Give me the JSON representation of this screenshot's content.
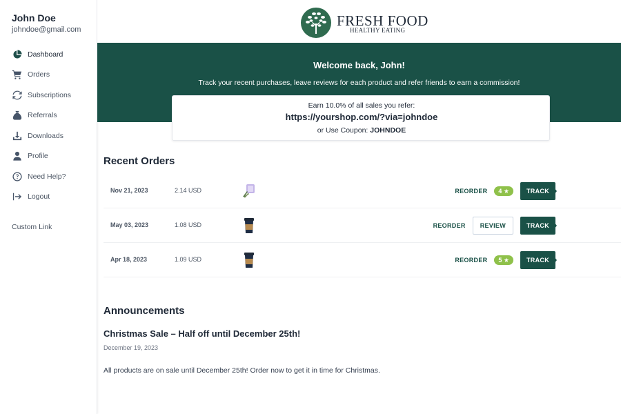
{
  "user": {
    "name": "John Doe",
    "email": "johndoe@gmail.com"
  },
  "sidebar": {
    "items": [
      {
        "label": "Dashboard",
        "icon": "dashboard-icon",
        "active": true
      },
      {
        "label": "Orders",
        "icon": "cart-icon"
      },
      {
        "label": "Subscriptions",
        "icon": "refresh-icon"
      },
      {
        "label": "Referrals",
        "icon": "money-bag-icon"
      },
      {
        "label": "Downloads",
        "icon": "download-icon"
      },
      {
        "label": "Profile",
        "icon": "user-icon"
      },
      {
        "label": "Need Help?",
        "icon": "help-icon"
      },
      {
        "label": "Logout",
        "icon": "logout-icon"
      }
    ],
    "custom_link": "Custom Link"
  },
  "brand": {
    "title": "FRESH FOOD",
    "subtitle": "HEALTHY EATING",
    "logo_icon": "tree-icon"
  },
  "hero": {
    "title": "Welcome back, John!",
    "subtitle": "Track your recent purchases, leave reviews for each product and refer friends to earn a commission!",
    "earn_text": "Earn 10.0% of all sales you refer:",
    "referral_url": "https://yourshop.com/?via=johndoe",
    "coupon_prefix": "or Use Coupon:",
    "coupon_code": "JOHNDOE",
    "color": "#1a5147"
  },
  "orders": {
    "title": "Recent Orders",
    "reorder_label": "REORDER",
    "track_label": "TRACK",
    "review_label": "REVIEW",
    "rows": [
      {
        "date": "Nov 21, 2023",
        "price": "2.14 USD",
        "image": "lavender-product-icon",
        "rating": "4 ★"
      },
      {
        "date": "May 03, 2023",
        "price": "1.08 USD",
        "image": "coffee-cup-icon",
        "review": true
      },
      {
        "date": "Apr 18, 2023",
        "price": "1.09 USD",
        "image": "coffee-cup-icon",
        "rating": "5 ★"
      }
    ]
  },
  "announcements": {
    "title": "Announcements",
    "items": [
      {
        "title": "Christmas Sale – Half off until December 25th!",
        "date": "December 19, 2023",
        "body": "All products are on sale until December 25th! Order now to get it in time for Christmas."
      }
    ]
  }
}
